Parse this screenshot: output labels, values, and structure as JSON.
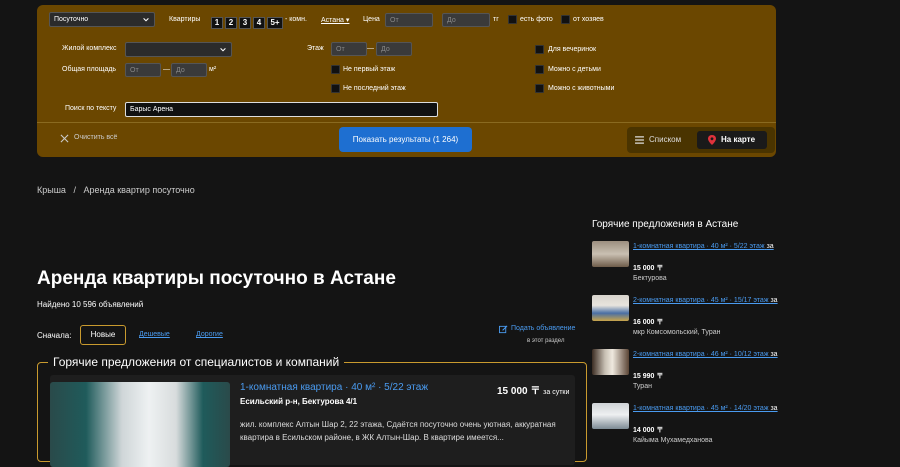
{
  "filters": {
    "rent_type": "Посуточно",
    "rooms_label": "Квартиры",
    "rooms": [
      "1",
      "2",
      "3",
      "4",
      "5+"
    ],
    "rooms_suffix": "- комн.",
    "city": "Астана",
    "price_label": "Цена",
    "price_from_ph": "От",
    "price_to_ph": "До",
    "currency": "тг",
    "has_photo": "есть фото",
    "from_owner": "от хозяев",
    "complex_label": "Жилой комплекс",
    "floor_label": "Этаж",
    "floor_from_ph": "От",
    "floor_to_ph": "До",
    "dash": "—",
    "for_parties": "Для вечеринок",
    "area_label": "Общая площадь",
    "area_from_ph": "От",
    "area_to_ph": "До",
    "area_unit": "м²",
    "not_first_floor": "Не первый этаж",
    "with_kids": "Можно с детьми",
    "not_last_floor": "Не последний этаж",
    "with_pets": "Можно с животными",
    "search_label": "Поиск по тексту",
    "search_value": "Барыс Арена",
    "clear_all": "Очистить всё",
    "show_results": "Показать результаты (1 264)",
    "view_list": "Списком",
    "view_map": "На карте"
  },
  "breadcrumb": {
    "home": "Крыша",
    "sep": "/",
    "current": "Аренда квартир посуточно"
  },
  "main": {
    "title": "Аренда квартиры посуточно в Астане",
    "found": "Найдено 10 596 объявлений",
    "sort_label": "Сначала:",
    "sort_new": "Новые",
    "sort_cheap": "Дешевые",
    "sort_expensive": "Дорогие",
    "post_ad": "Подать объявление",
    "post_ad_sub": "в этот раздел"
  },
  "hot_box": {
    "title": "Горячие предложения от специалистов и компаний",
    "listing": {
      "title": "1-комнатная квартира · 40 м² · 5/22 этаж",
      "price": "15 000 〒",
      "per": "за сутки",
      "address": "Есильский р-н, Бектурова 4/1",
      "desc": "жил. комплекс Алтын Шар 2, 22 этажа, Сдаётся посуточно очень уютная, аккуратная квартира в Есильском районе, в ЖК Алтын-Шар. В квартире имеется..."
    }
  },
  "sidebar": {
    "title": "Горячие предложения в Астане",
    "za": "за",
    "items": [
      {
        "title": "1-комнатная квартира · 40 м² · 5/22 этаж",
        "price": "15 000 〒",
        "loc": "Бектурова"
      },
      {
        "title": "2-комнатная квартира · 45 м² · 15/17 этаж",
        "price": "16 000 〒",
        "loc": "мкр Комсомольский, Туран"
      },
      {
        "title": "2-комнатная квартира · 46 м² · 10/12 этаж",
        "price": "15 990 〒",
        "loc": "Туран"
      },
      {
        "title": "1-комнатная квартира · 45 м² · 14/20 этаж",
        "price": "14 000 〒",
        "loc": "Кайыма Мухамедханова"
      }
    ]
  },
  "colors": {
    "filter_bg": "#6b4700",
    "accent_blue": "#1e6fd1",
    "link_blue": "#4a9bf0",
    "gold_border": "#c99a2e"
  }
}
